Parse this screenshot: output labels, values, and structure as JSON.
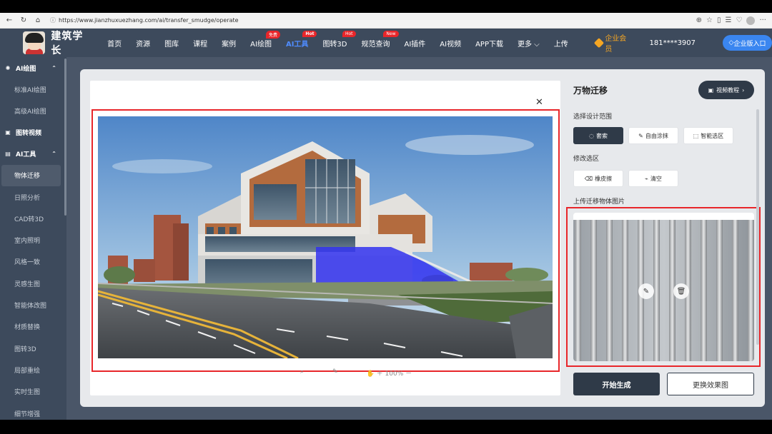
{
  "browser": {
    "url": "https://www.jianzhuxuezhang.com/ai/transfer_smudge/operate"
  },
  "header": {
    "brand": "建筑学长",
    "nav": [
      {
        "label": "首页",
        "badge": ""
      },
      {
        "label": "资源",
        "badge": ""
      },
      {
        "label": "图库",
        "badge": ""
      },
      {
        "label": "课程",
        "badge": ""
      },
      {
        "label": "案例",
        "badge": ""
      },
      {
        "label": "AI绘图",
        "badge": "免费"
      },
      {
        "label": "AI工具",
        "badge": "Hot"
      },
      {
        "label": "图转3D",
        "badge": "Hot"
      },
      {
        "label": "规范查询",
        "badge": "New"
      },
      {
        "label": "AI插件",
        "badge": ""
      },
      {
        "label": "AI视频",
        "badge": ""
      },
      {
        "label": "APP下载",
        "badge": ""
      },
      {
        "label": "更多",
        "badge": ""
      },
      {
        "label": "上传",
        "badge": ""
      }
    ],
    "vip": "企业会员",
    "phone": "181****3907",
    "enterprise": "企业版入口"
  },
  "sidebar": {
    "group1": "AI绘图",
    "group1_items": [
      "标准AI绘图",
      "高级AI绘图"
    ],
    "group2": "图转视频",
    "group3": "AI工具",
    "group3_items": [
      "物体迁移",
      "日照分析",
      "CAD转3D",
      "室内照明",
      "风格一致",
      "灵感生图",
      "智能体改图",
      "材质替换",
      "图转3D",
      "局部重绘",
      "实时生图",
      "细节增强"
    ]
  },
  "canvas": {
    "zoom": "100%"
  },
  "right": {
    "title": "万物迁移",
    "video": "视频教程",
    "range_label": "选择设计范围",
    "range_tools": [
      "套索",
      "自由涂抹",
      "智能选区"
    ],
    "modify_label": "修改选区",
    "modify_tools": [
      "橡皮擦",
      "清空"
    ],
    "upload_label": "上传迁移物体图片",
    "generate": "开始生成",
    "swap": "更换效果图"
  },
  "colors": {
    "header_bg": "#3d4a5c",
    "accent_blue": "#3a86f0",
    "highlight_red": "#e8262a",
    "mask_blue": "#3232f0"
  }
}
